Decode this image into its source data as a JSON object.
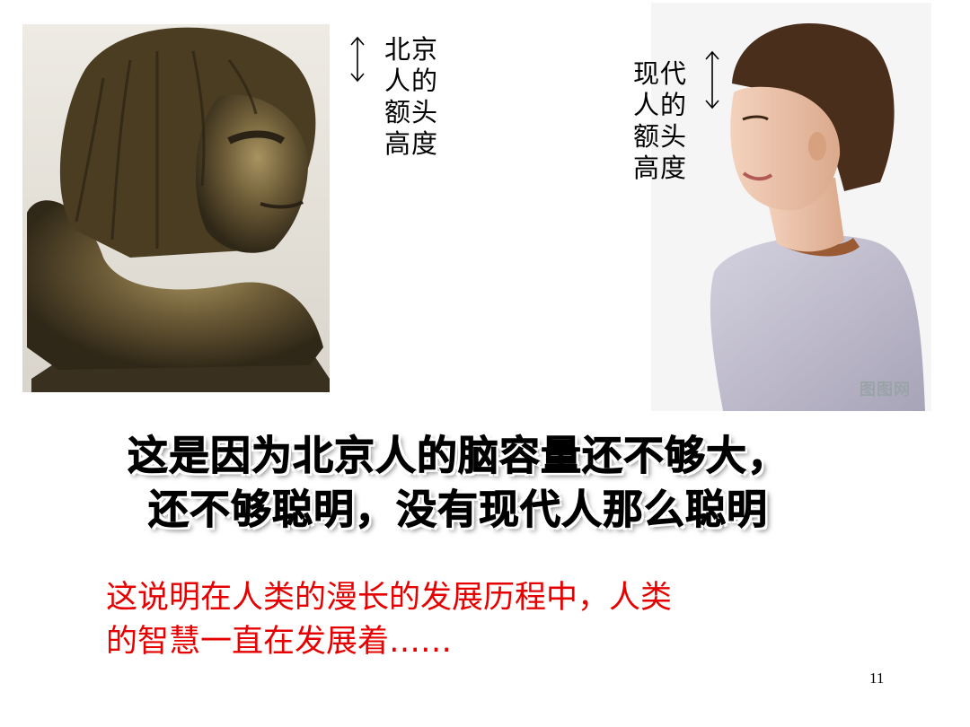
{
  "labels": {
    "peking": [
      "北京",
      "人的",
      "额头",
      "高度"
    ],
    "modern": [
      "现代",
      "人的",
      "额头",
      "高度"
    ]
  },
  "headline": {
    "line1": "这是因为北京人的脑容量还不够大，",
    "line2": "还不够聪明，没有现代人那么聪明"
  },
  "note": {
    "line1": "这说明在人类的漫长的发展历程中，人类",
    "line2": "的智慧一直在发展着……"
  },
  "watermark": "图图网",
  "page_number": "11",
  "colors": {
    "note_text": "#e60000",
    "headline_text": "#000000",
    "bronze": "#6b5a36"
  },
  "images": {
    "left": "bronze-bust-of-peking-man",
    "right": "profile-of-modern-woman"
  }
}
